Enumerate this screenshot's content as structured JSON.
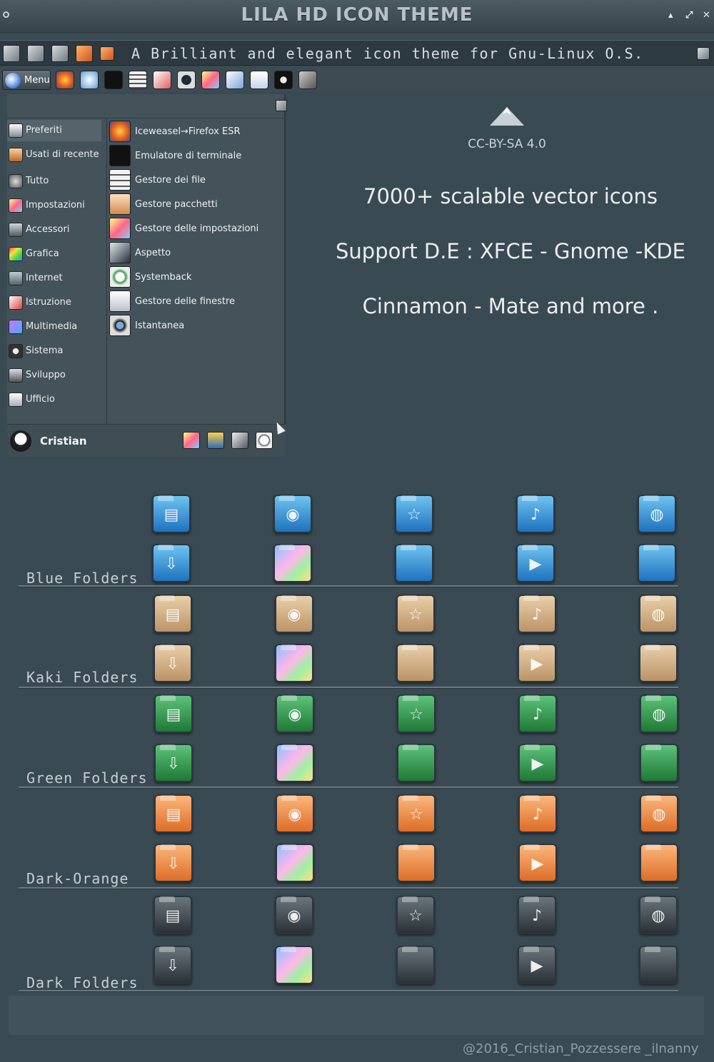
{
  "window": {
    "title": "LILA HD ICON THEME",
    "min_glyph": "▴",
    "max_glyph": "⤢",
    "close_glyph": "✕"
  },
  "toolbar": {
    "slogan": "A Brilliant and elegant icon theme for Gnu-Linux O.S."
  },
  "taskbar": {
    "menu_label": "Menu"
  },
  "menu": {
    "categories": [
      {
        "label": "Preferiti"
      },
      {
        "label": "Usati di recente"
      },
      {
        "label": "Tutto"
      },
      {
        "label": "Impostazioni"
      },
      {
        "label": "Accessori"
      },
      {
        "label": "Grafica"
      },
      {
        "label": "Internet"
      },
      {
        "label": "Istruzione"
      },
      {
        "label": "Multimedia"
      },
      {
        "label": "Sistema"
      },
      {
        "label": "Sviluppo"
      },
      {
        "label": "Ufficio"
      }
    ],
    "apps": [
      {
        "label": "Iceweasel→Firefox ESR"
      },
      {
        "label": "Emulatore di terminale"
      },
      {
        "label": "Gestore dei file"
      },
      {
        "label": "Gestore pacchetti"
      },
      {
        "label": "Gestore delle impostazioni"
      },
      {
        "label": "Aspetto"
      },
      {
        "label": "Systemback"
      },
      {
        "label": "Gestore delle finestre"
      },
      {
        "label": "Istantanea"
      }
    ],
    "user": "Cristian"
  },
  "info": {
    "license": "CC-BY-SA 4.0",
    "line1": "7000+ scalable vector icons",
    "line2": "Support D.E : XFCE - Gnome -KDE",
    "line3": "Cinnamon - Mate  and more ."
  },
  "folder_sections": [
    {
      "label": "Blue Folders",
      "color": "blue"
    },
    {
      "label": "Kaki Folders",
      "color": "kaki"
    },
    {
      "label": "Green Folders",
      "color": "green"
    },
    {
      "label": "Dark-Orange",
      "color": "orange"
    },
    {
      "label": "Dark Folders",
      "color": "dark"
    }
  ],
  "folder_glyphs": {
    "row1": [
      "▤",
      "◉",
      "☆",
      "♪",
      "◍"
    ],
    "row2": [
      "⇩",
      "",
      "",
      "▶",
      ""
    ]
  },
  "footer": {
    "copyright": "@2016_Cristian_Pozzessere _ilnanny"
  }
}
